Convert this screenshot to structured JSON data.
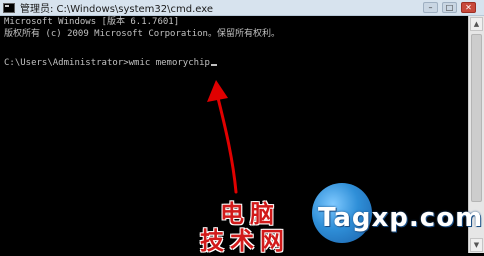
{
  "window": {
    "title": "管理员: C:\\Windows\\system32\\cmd.exe",
    "minimize_glyph": "–",
    "maximize_glyph": "□",
    "close_glyph": "✕"
  },
  "console": {
    "lines": [
      "Microsoft Windows [版本 6.1.7601]",
      "版权所有 (c) 2009 Microsoft Corporation。保留所有权利。",
      "",
      "C:\\Users\\Administrator>wmic memorychip"
    ]
  },
  "annotation": {
    "arrow_color": "#e00000"
  },
  "watermark": {
    "cn_line1": "电脑",
    "cn_line2": "技术网",
    "en": "Tagxp.com",
    "cn_color": "#d11a1a",
    "en_color": "#ffffff"
  }
}
